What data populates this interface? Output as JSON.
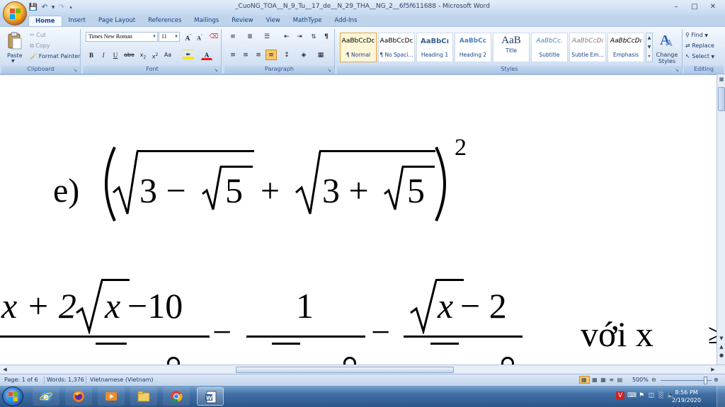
{
  "window": {
    "title": "_CuoNG_TOA__N_9_Tu__17_de__N_29_THA__NG_2__6f5f611688 - Microsoft Word",
    "controls": [
      "–",
      "□",
      "✕"
    ]
  },
  "tabs": [
    "Home",
    "Insert",
    "Page Layout",
    "References",
    "Mailings",
    "Review",
    "View",
    "MathType",
    "Add-Ins"
  ],
  "active_tab": "Home",
  "ribbon": {
    "clipboard": {
      "label": "Clipboard",
      "paste": "Paste",
      "cut": "Cut",
      "copy": "Copy",
      "format_painter": "Format Painter"
    },
    "font": {
      "label": "Font",
      "font_name": "Times New Roman",
      "font_size": "11"
    },
    "paragraph": {
      "label": "Paragraph"
    },
    "styles": {
      "label": "Styles",
      "items": [
        {
          "preview": "AaBbCcDc",
          "name": "¶ Normal"
        },
        {
          "preview": "AaBbCcDc",
          "name": "¶ No Spaci..."
        },
        {
          "preview": "AaBbCı",
          "name": "Heading 1"
        },
        {
          "preview": "AaBbCc",
          "name": "Heading 2"
        },
        {
          "preview": "AaB",
          "name": "Title"
        },
        {
          "preview": "AaBbCc.",
          "name": "Subtitle"
        },
        {
          "preview": "AaBbCcDı",
          "name": "Subtle Em..."
        },
        {
          "preview": "AaBbCcDı",
          "name": "Emphasis"
        }
      ],
      "change_styles": "Change Styles"
    },
    "editing": {
      "label": "Editing",
      "find": "Find",
      "replace": "Replace",
      "select": "Select"
    }
  },
  "document": {
    "eq_label": "e)",
    "eq_t1": "3 − ",
    "eq_s1": "5",
    "eq_plus": "+",
    "eq_t2": "3 + ",
    "eq_s2": "5",
    "eq_exp": "2",
    "frac1_num_a": "x + 2",
    "frac1_num_x": "x",
    "frac1_num_b": " −10",
    "minus": "−",
    "frac2_num": "1",
    "frac3_num_x": "x",
    "frac3_num_b": " − 2",
    "voi": "với  x"
  },
  "status": {
    "page": "Page: 1 of 6",
    "words": "Words: 1,376",
    "language": "Vietnamese (Vietnam)",
    "zoom": "500%"
  },
  "taskbar": {
    "time": "8:56 PM",
    "date": "2/19/2020"
  }
}
